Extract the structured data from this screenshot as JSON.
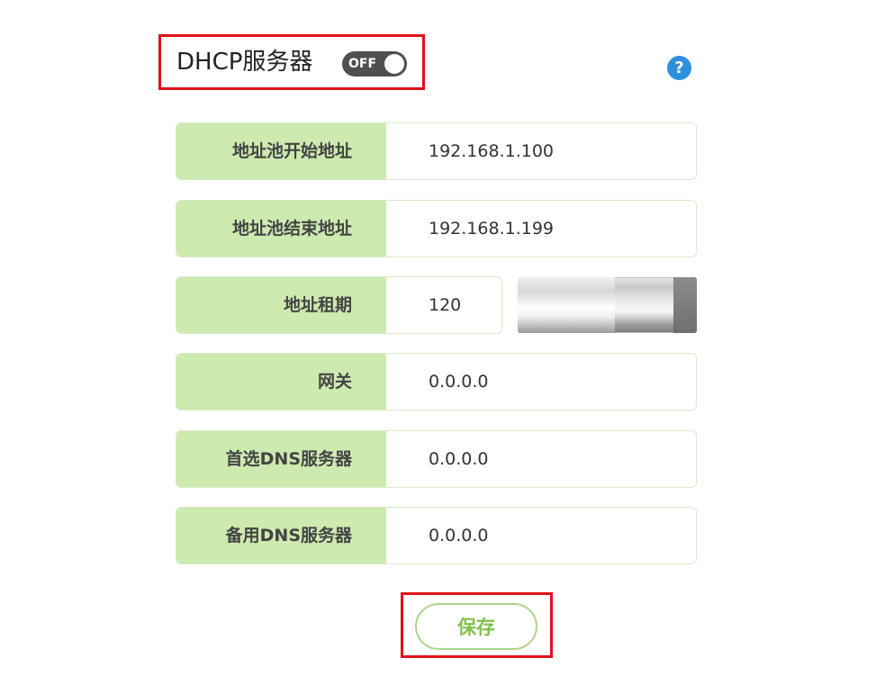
{
  "header": {
    "title": "DHCP服务器",
    "toggle_label": "OFF",
    "help_symbol": "?"
  },
  "form": {
    "pool_start": {
      "label": "地址池开始地址",
      "value": "192.168.1.100"
    },
    "pool_end": {
      "label": "地址池结束地址",
      "value": "192.168.1.199"
    },
    "lease": {
      "label": "地址租期",
      "value": "120"
    },
    "gateway": {
      "label": "网关",
      "value": "0.0.0.0"
    },
    "primary_dns": {
      "label": "首选DNS服务器",
      "value": "0.0.0.0"
    },
    "secondary_dns": {
      "label": "备用DNS服务器",
      "value": "0.0.0.0"
    }
  },
  "actions": {
    "save_label": "保存"
  },
  "colors": {
    "label_bg": "#cdeab0",
    "accent_green": "#82c14a",
    "highlight_red": "#e0111a",
    "help_blue": "#2d8fe0",
    "toggle_bg": "#4f4f4f"
  }
}
